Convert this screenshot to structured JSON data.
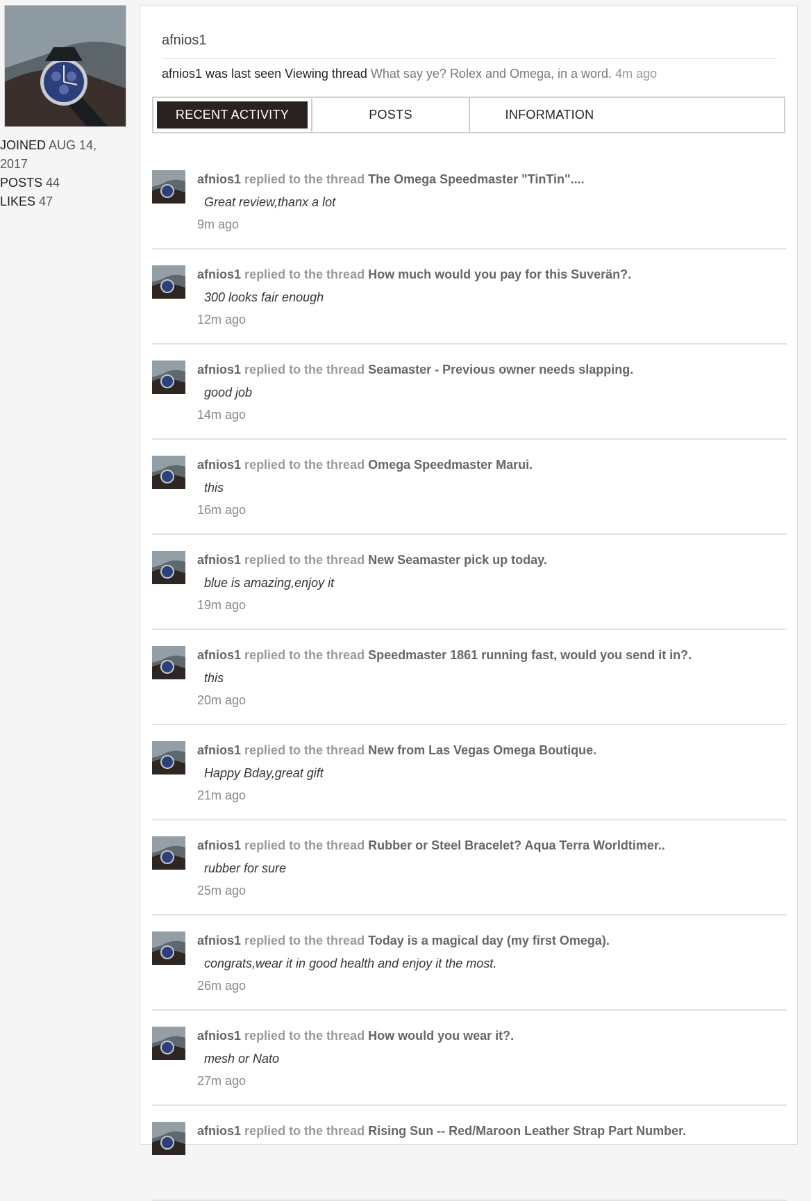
{
  "profile": {
    "username": "afnios1",
    "joined_label": "JOINED",
    "joined_value": "AUG 14, 2017",
    "posts_label": "POSTS",
    "posts_value": "44",
    "likes_label": "LIKES",
    "likes_value": "47"
  },
  "last_seen": {
    "prefix": "afnios1 was last seen",
    "action": "Viewing thread",
    "thread": "What say ye? Rolex and Omega, in a word.",
    "time": "4m ago"
  },
  "tabs": [
    "RECENT ACTIVITY",
    "POSTS",
    "INFORMATION"
  ],
  "activity": [
    {
      "user": "afnios1",
      "verb": "replied to the thread",
      "thread": "The Omega Speedmaster \"TinTin\"....",
      "snippet": "Great review,thanx a lot",
      "time": "9m ago"
    },
    {
      "user": "afnios1",
      "verb": "replied to the thread",
      "thread": "How much would you pay for this Suverän?.",
      "snippet": "300 looks fair enough",
      "time": "12m ago"
    },
    {
      "user": "afnios1",
      "verb": "replied to the thread",
      "thread": "Seamaster - Previous owner needs slapping.",
      "snippet": "good job",
      "time": "14m ago"
    },
    {
      "user": "afnios1",
      "verb": "replied to the thread",
      "thread": "Omega Speedmaster Marui.",
      "snippet": "this",
      "time": "16m ago"
    },
    {
      "user": "afnios1",
      "verb": "replied to the thread",
      "thread": "New Seamaster pick up today.",
      "snippet": "blue is amazing,enjoy it",
      "time": "19m ago"
    },
    {
      "user": "afnios1",
      "verb": "replied to the thread",
      "thread": "Speedmaster 1861 running fast, would you send it in?.",
      "snippet": "this",
      "time": "20m ago"
    },
    {
      "user": "afnios1",
      "verb": "replied to the thread",
      "thread": "New from Las Vegas Omega Boutique.",
      "snippet": "Happy Bday,great gift",
      "time": "21m ago"
    },
    {
      "user": "afnios1",
      "verb": "replied to the thread",
      "thread": "Rubber or Steel Bracelet? Aqua Terra Worldtimer..",
      "snippet": "rubber for sure",
      "time": "25m ago"
    },
    {
      "user": "afnios1",
      "verb": "replied to the thread",
      "thread": "Today is a magical day (my first Omega).",
      "snippet": "congrats,wear it in good health and enjoy it the most.",
      "time": "26m ago"
    },
    {
      "user": "afnios1",
      "verb": "replied to the thread",
      "thread": "How would you wear it?.",
      "snippet": "mesh or Nato",
      "time": "27m ago"
    },
    {
      "user": "afnios1",
      "verb": "replied to the thread",
      "thread": "Rising Sun -- Red/Maroon Leather Strap Part Number.",
      "snippet": "",
      "time": ""
    }
  ]
}
